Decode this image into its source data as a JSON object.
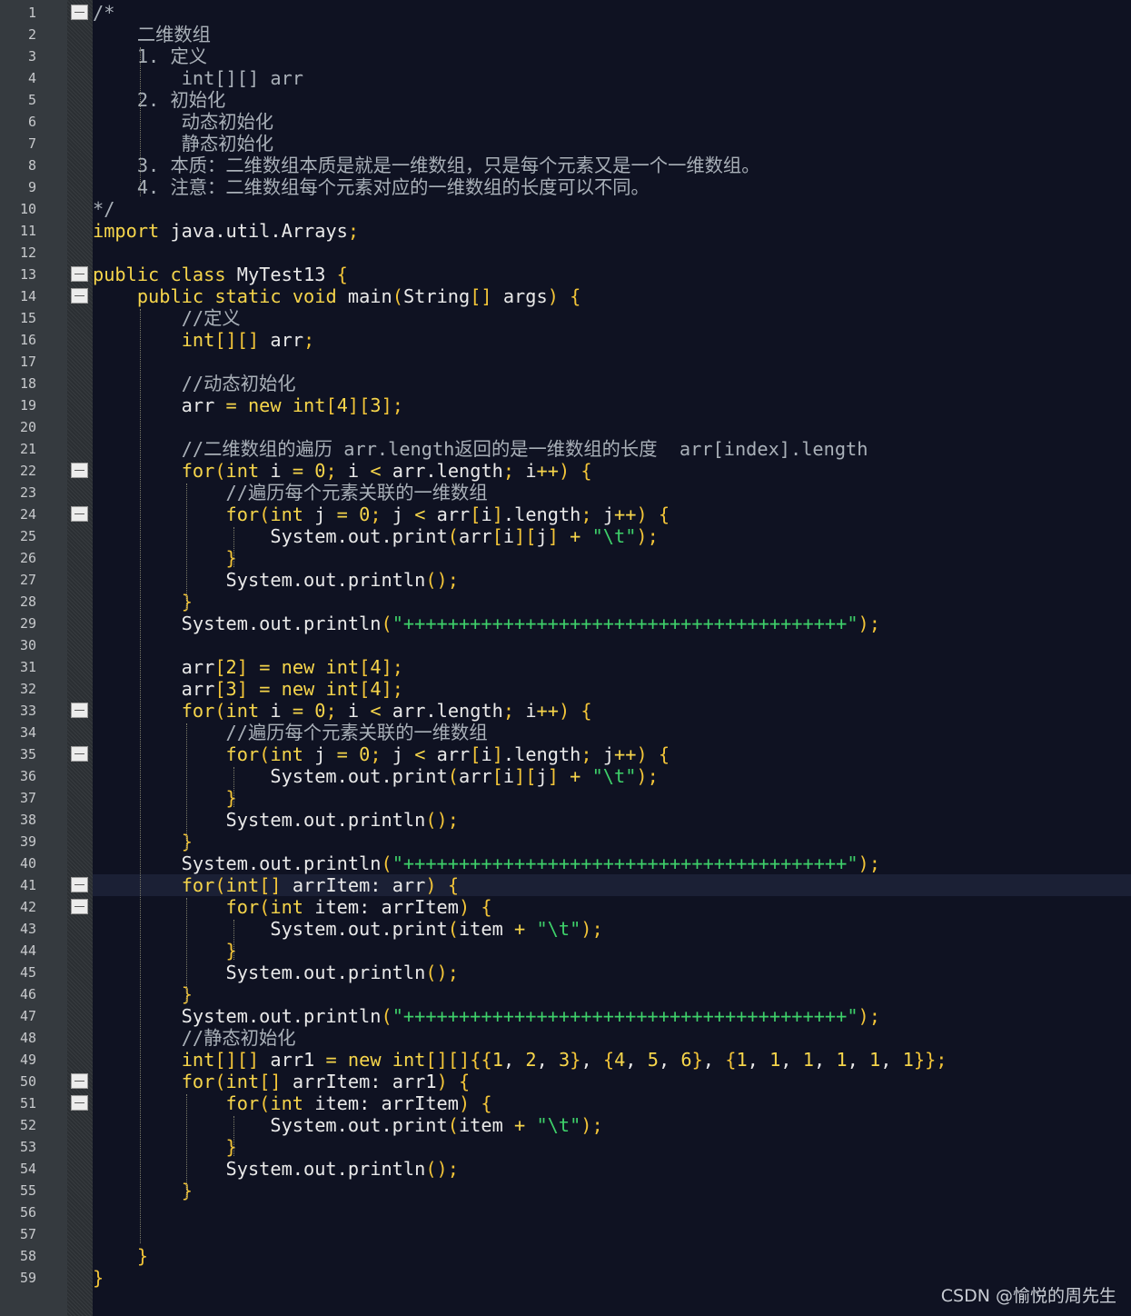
{
  "editor": {
    "language": "java",
    "current_line": 41,
    "fold_markers": [
      1,
      13,
      14,
      22,
      24,
      33,
      35,
      41,
      42,
      50,
      51
    ],
    "colors": {
      "background": "#0f1222",
      "keyword": "#f6d54b",
      "string": "#3ed06a",
      "comment": "#a9b0b8",
      "text": "#e9e9e9"
    },
    "lines": [
      {
        "no": "1",
        "text": "/*",
        "type": "comment"
      },
      {
        "no": "2",
        "text": "    二维数组",
        "type": "comment"
      },
      {
        "no": "3",
        "text": "    1. 定义",
        "type": "comment"
      },
      {
        "no": "4",
        "text": "        int[][] arr",
        "type": "comment"
      },
      {
        "no": "5",
        "text": "    2. 初始化",
        "type": "comment"
      },
      {
        "no": "6",
        "text": "        动态初始化",
        "type": "comment"
      },
      {
        "no": "7",
        "text": "        静态初始化",
        "type": "comment"
      },
      {
        "no": "8",
        "text": "    3. 本质：二维数组本质是就是一维数组，只是每个元素又是一个一维数组。",
        "type": "comment"
      },
      {
        "no": "9",
        "text": "    4. 注意：二维数组每个元素对应的一维数组的长度可以不同。",
        "type": "comment"
      },
      {
        "no": "10",
        "text": "*/",
        "type": "comment"
      },
      {
        "no": "11",
        "text": "import java.util.Arrays;",
        "type": "code"
      },
      {
        "no": "12",
        "text": "",
        "type": "code"
      },
      {
        "no": "13",
        "text": "public class MyTest13 {",
        "type": "code"
      },
      {
        "no": "14",
        "text": "    public static void main(String[] args) {",
        "type": "code"
      },
      {
        "no": "15",
        "text": "        //定义",
        "type": "code"
      },
      {
        "no": "16",
        "text": "        int[][] arr;",
        "type": "code"
      },
      {
        "no": "17",
        "text": "",
        "type": "code"
      },
      {
        "no": "18",
        "text": "        //动态初始化",
        "type": "code"
      },
      {
        "no": "19",
        "text": "        arr = new int[4][3];",
        "type": "code"
      },
      {
        "no": "20",
        "text": "",
        "type": "code"
      },
      {
        "no": "21",
        "text": "        //二维数组的遍历 arr.length返回的是一维数组的长度  arr[index].length",
        "type": "code"
      },
      {
        "no": "22",
        "text": "        for(int i = 0; i < arr.length; i++) {",
        "type": "code"
      },
      {
        "no": "23",
        "text": "            //遍历每个元素关联的一维数组",
        "type": "code"
      },
      {
        "no": "24",
        "text": "            for(int j = 0; j < arr[i].length; j++) {",
        "type": "code"
      },
      {
        "no": "25",
        "text": "                System.out.print(arr[i][j] + \"\\t\");",
        "type": "code"
      },
      {
        "no": "26",
        "text": "            }",
        "type": "code"
      },
      {
        "no": "27",
        "text": "            System.out.println();",
        "type": "code"
      },
      {
        "no": "28",
        "text": "        }",
        "type": "code"
      },
      {
        "no": "29",
        "text": "        System.out.println(\"++++++++++++++++++++++++++++++++++++++++\");",
        "type": "code"
      },
      {
        "no": "30",
        "text": "",
        "type": "code"
      },
      {
        "no": "31",
        "text": "        arr[2] = new int[4];",
        "type": "code"
      },
      {
        "no": "32",
        "text": "        arr[3] = new int[4];",
        "type": "code"
      },
      {
        "no": "33",
        "text": "        for(int i = 0; i < arr.length; i++) {",
        "type": "code"
      },
      {
        "no": "34",
        "text": "            //遍历每个元素关联的一维数组",
        "type": "code"
      },
      {
        "no": "35",
        "text": "            for(int j = 0; j < arr[i].length; j++) {",
        "type": "code"
      },
      {
        "no": "36",
        "text": "                System.out.print(arr[i][j] + \"\\t\");",
        "type": "code"
      },
      {
        "no": "37",
        "text": "            }",
        "type": "code"
      },
      {
        "no": "38",
        "text": "            System.out.println();",
        "type": "code"
      },
      {
        "no": "39",
        "text": "        }",
        "type": "code"
      },
      {
        "no": "40",
        "text": "        System.out.println(\"++++++++++++++++++++++++++++++++++++++++\");",
        "type": "code"
      },
      {
        "no": "41",
        "text": "        for(int[] arrItem: arr) {",
        "type": "code"
      },
      {
        "no": "42",
        "text": "            for(int item: arrItem) {",
        "type": "code"
      },
      {
        "no": "43",
        "text": "                System.out.print(item + \"\\t\");",
        "type": "code"
      },
      {
        "no": "44",
        "text": "            }",
        "type": "code"
      },
      {
        "no": "45",
        "text": "            System.out.println();",
        "type": "code"
      },
      {
        "no": "46",
        "text": "        }",
        "type": "code"
      },
      {
        "no": "47",
        "text": "        System.out.println(\"++++++++++++++++++++++++++++++++++++++++\");",
        "type": "code"
      },
      {
        "no": "48",
        "text": "        //静态初始化",
        "type": "code"
      },
      {
        "no": "49",
        "text": "        int[][] arr1 = new int[][]{{1, 2, 3}, {4, 5, 6}, {1, 1, 1, 1, 1, 1}};",
        "type": "code"
      },
      {
        "no": "50",
        "text": "        for(int[] arrItem: arr1) {",
        "type": "code"
      },
      {
        "no": "51",
        "text": "            for(int item: arrItem) {",
        "type": "code"
      },
      {
        "no": "52",
        "text": "                System.out.print(item + \"\\t\");",
        "type": "code"
      },
      {
        "no": "53",
        "text": "            }",
        "type": "code"
      },
      {
        "no": "54",
        "text": "            System.out.println();",
        "type": "code"
      },
      {
        "no": "55",
        "text": "        }",
        "type": "code"
      },
      {
        "no": "56",
        "text": "",
        "type": "code"
      },
      {
        "no": "57",
        "text": "",
        "type": "code"
      },
      {
        "no": "58",
        "text": "    }",
        "type": "code"
      },
      {
        "no": "59",
        "text": "}",
        "type": "code"
      }
    ]
  },
  "watermark": "CSDN @愉悦的周先生"
}
